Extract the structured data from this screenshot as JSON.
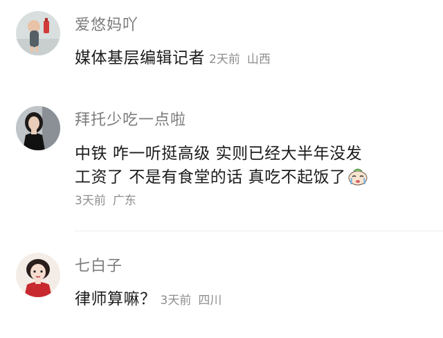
{
  "comments": [
    {
      "username": "爱悠妈吖",
      "text": "媒体基层编辑记者",
      "time": "2天前",
      "location": "山西",
      "avatar_icon": "baby-photo-avatar"
    },
    {
      "username": "拜托少吃一点啦",
      "text_line1": "中铁  咋一听挺高级 实则已经大半年没发",
      "text_line2": "工资了 不是有食堂的话 真吃不起饭了",
      "emoji_icon": "crying-face-emoji",
      "time": "3天前",
      "location": "广东",
      "avatar_icon": "woman-photo-avatar"
    },
    {
      "username": "七白子",
      "text": "律师算嘛？",
      "time": "3天前",
      "location": "四川",
      "avatar_icon": "cartoon-girl-avatar"
    }
  ],
  "colors": {
    "username": "#7b7b7b",
    "text": "#1b1b1b",
    "meta": "#8e8e8e",
    "divider": "#ececec",
    "background": "#ffffff"
  }
}
